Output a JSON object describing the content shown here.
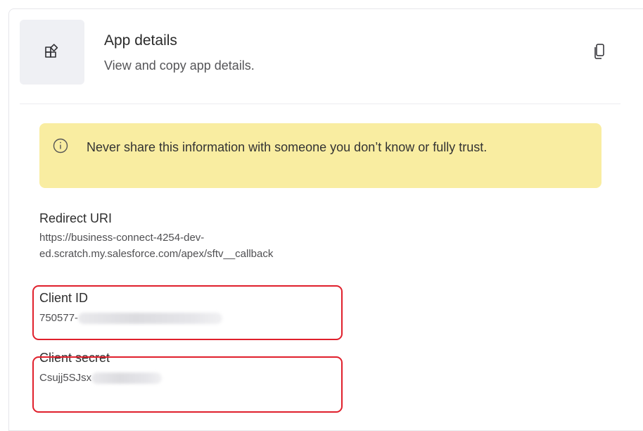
{
  "header": {
    "title": "App details",
    "subtitle": "View and copy app details.",
    "icon": "apps-icon",
    "copy_icon": "copy-icon"
  },
  "warning": {
    "icon": "info-icon",
    "text": "Never share this information with someone you don’t know or fully trust.",
    "background": "#f9eda1"
  },
  "fields": {
    "redirect_uri": {
      "label": "Redirect URI",
      "value_line1": "https://business-connect-4254-dev-",
      "value_line2": "ed.scratch.my.salesforce.com/apex/sftv__callback"
    },
    "client_id": {
      "label": "Client ID",
      "value_visible": "750577-"
    },
    "client_secret": {
      "label": "Client secret",
      "value_visible": "Csujj5SJsx"
    }
  },
  "colors": {
    "highlight": "#e0202c",
    "icon_tile": "#eff0f4"
  }
}
